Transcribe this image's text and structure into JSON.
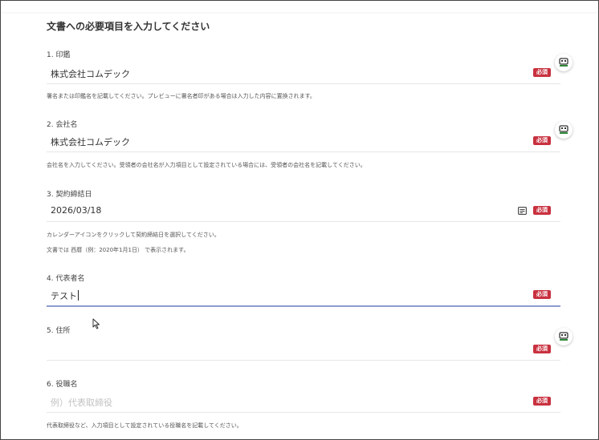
{
  "section_title": "文書への必要項目を入力してください",
  "required_badge": "必須",
  "colors": {
    "required": "#c8313f",
    "focus_underline": "#8d9bcf",
    "icon_green": "#2f8a3b"
  },
  "fields": [
    {
      "label": "1. 印鑑",
      "value": "株式会社コムデック",
      "help": [
        "署名または印鑑名を記載してください。プレビューに署名者印がある場合は入力した内容に置換されます。"
      ],
      "side_icon": "stamp-icon"
    },
    {
      "label": "2. 会社名",
      "value": "株式会社コムデック",
      "help": [
        "会社名を入力してください。受領者の会社名が入力項目として設定されている場合には、受領者の会社名を記載してください。"
      ],
      "side_icon": "stamp-icon"
    },
    {
      "label": "3. 契約締結日",
      "value": "2026/03/18",
      "help": [
        "カレンダーアイコンをクリックして契約締結日を選択してください。",
        "文書では 西暦（例：2020年1月1日） で表示されます。"
      ],
      "icon": "calendar-icon"
    },
    {
      "label": "4. 代表者名",
      "value": "テスト",
      "focused": true
    },
    {
      "label": "5. 住所",
      "value": "",
      "side_icon": "stamp-icon"
    },
    {
      "label": "6. 役職名",
      "value": "",
      "placeholder": "例）代表取締役",
      "help": [
        "代表取締役など、入力項目として設定されている役職名を記載してください。"
      ]
    }
  ]
}
